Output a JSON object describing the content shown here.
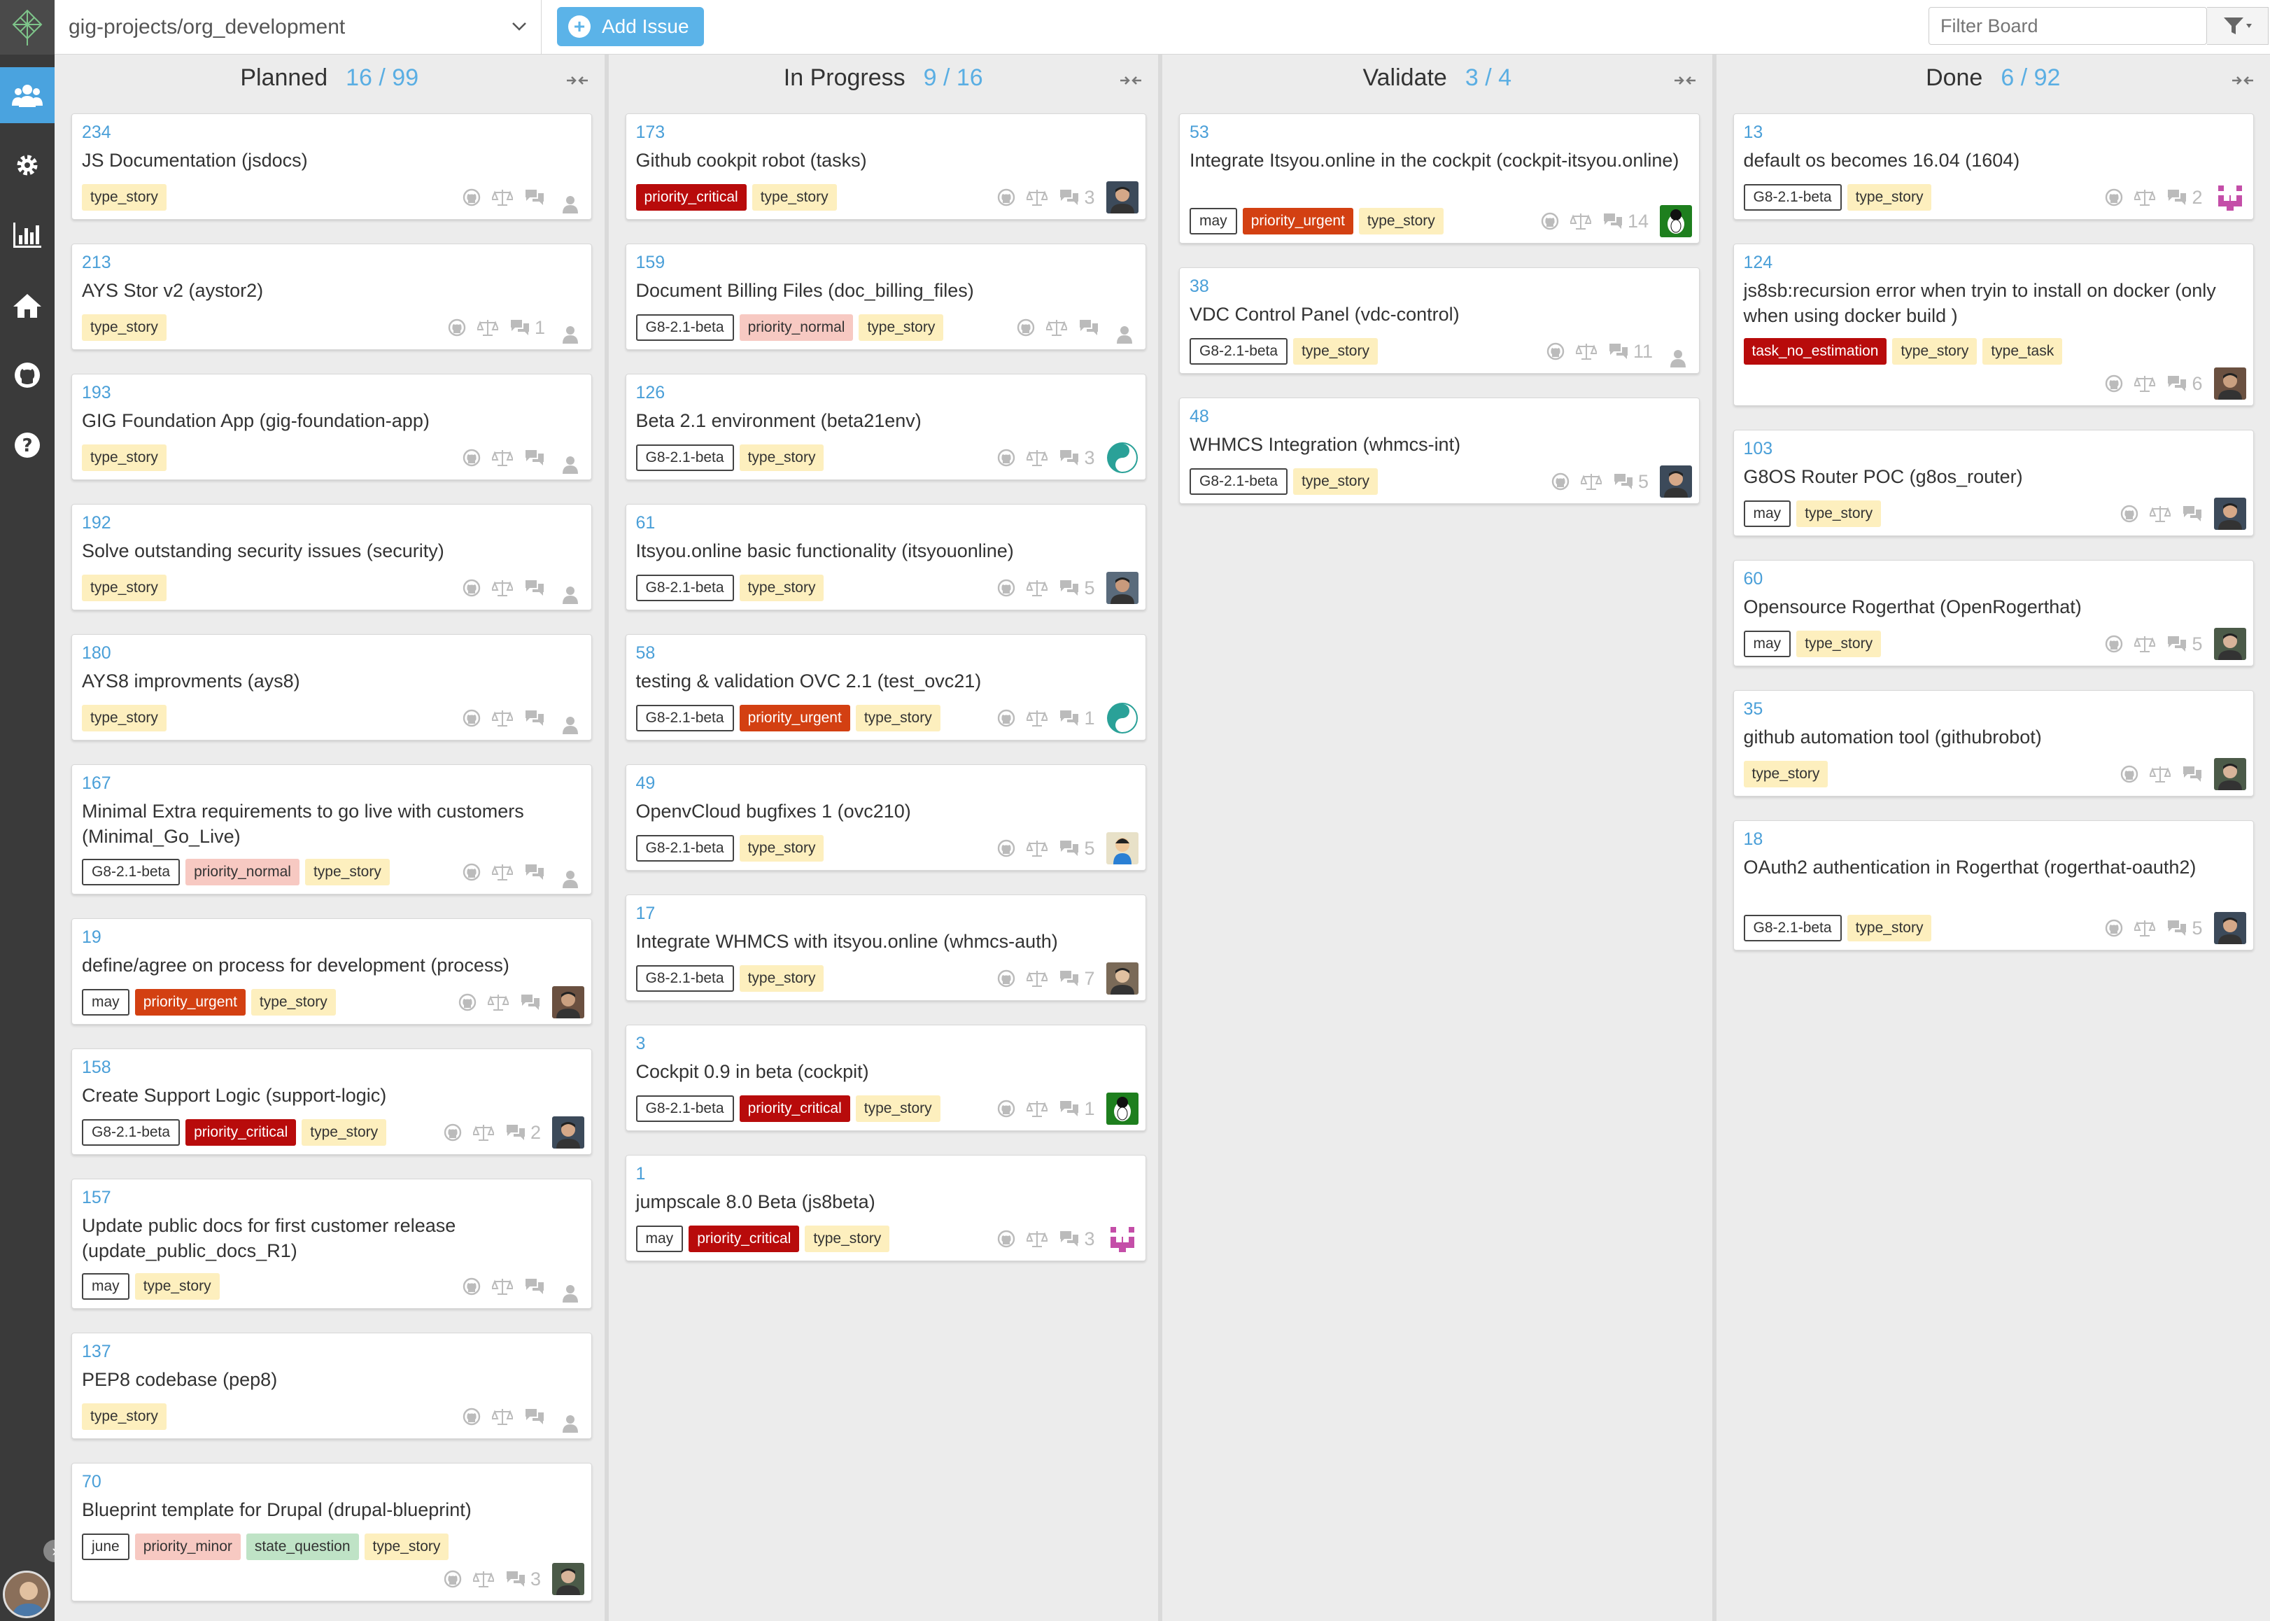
{
  "topbar": {
    "repo": "gig-projects/org_development",
    "add_issue": "Add Issue",
    "filter_placeholder": "Filter Board"
  },
  "columns": [
    {
      "name": "Planned",
      "count": "16 / 99",
      "cards": [
        {
          "num": "234",
          "title": "JS Documentation (jsdocs)",
          "tags": [
            [
              "type_story",
              "type"
            ]
          ],
          "comments": "",
          "avatar": ""
        },
        {
          "num": "213",
          "title": "AYS Stor v2 (aystor2)",
          "tags": [
            [
              "type_story",
              "type"
            ]
          ],
          "comments": "1",
          "avatar": ""
        },
        {
          "num": "193",
          "title": "GIG Foundation App (gig-foundation-app)",
          "tags": [
            [
              "type_story",
              "type"
            ]
          ],
          "comments": "",
          "avatar": ""
        },
        {
          "num": "192",
          "title": "Solve outstanding security issues (security)",
          "tags": [
            [
              "type_story",
              "type"
            ]
          ],
          "comments": "",
          "avatar": ""
        },
        {
          "num": "180",
          "title": "AYS8 improvments (ays8)",
          "tags": [
            [
              "type_story",
              "type"
            ]
          ],
          "comments": "",
          "avatar": ""
        },
        {
          "num": "167",
          "title": "Minimal Extra requirements to go live with customers (Minimal_Go_Live)",
          "tags": [
            [
              "G8-2.1-beta",
              "ms"
            ],
            [
              "priority_normal",
              "norm"
            ],
            [
              "type_story",
              "type"
            ]
          ],
          "comments": "",
          "avatar": ""
        },
        {
          "num": "19",
          "title": "define/agree on process for development (process)",
          "tags": [
            [
              "may",
              "ms"
            ],
            [
              "priority_urgent",
              "urg"
            ],
            [
              "type_story",
              "type"
            ]
          ],
          "comments": "",
          "avatar": "photo"
        },
        {
          "num": "158",
          "title": "Create Support Logic (support-logic)",
          "tags": [
            [
              "G8-2.1-beta",
              "ms"
            ],
            [
              "priority_critical",
              "crit"
            ],
            [
              "type_story",
              "type"
            ]
          ],
          "comments": "2",
          "avatar": "photo"
        },
        {
          "num": "157",
          "title": "Update public docs for first customer release (update_public_docs_R1)",
          "tags": [
            [
              "may",
              "ms"
            ],
            [
              "type_story",
              "type"
            ]
          ],
          "comments": "",
          "avatar": ""
        },
        {
          "num": "137",
          "title": "PEP8 codebase (pep8)",
          "tags": [
            [
              "type_story",
              "type"
            ]
          ],
          "comments": "",
          "avatar": ""
        },
        {
          "num": "70",
          "title": "Blueprint template for Drupal (drupal-blueprint)",
          "tags": [
            [
              "june",
              "ms"
            ],
            [
              "priority_minor",
              "minor"
            ],
            [
              "state_question",
              "state"
            ],
            [
              "type_story",
              "type"
            ]
          ],
          "comments": "3",
          "avatar": "photo"
        }
      ]
    },
    {
      "name": "In Progress",
      "count": "9 / 16",
      "cards": [
        {
          "num": "173",
          "title": "Github cookpit robot (tasks)",
          "tags": [
            [
              "priority_critical",
              "crit"
            ],
            [
              "type_story",
              "type"
            ]
          ],
          "comments": "3",
          "avatar": "photo"
        },
        {
          "num": "159",
          "title": "Document Billing Files (doc_billing_files)",
          "tags": [
            [
              "G8-2.1-beta",
              "ms"
            ],
            [
              "priority_normal",
              "norm"
            ],
            [
              "type_story",
              "type"
            ]
          ],
          "comments": "",
          "avatar": ""
        },
        {
          "num": "126",
          "title": "Beta 2.1 environment (beta21env)",
          "tags": [
            [
              "G8-2.1-beta",
              "ms"
            ],
            [
              "type_story",
              "type"
            ]
          ],
          "comments": "3",
          "avatar": "yinyang"
        },
        {
          "num": "61",
          "title": "Itsyou.online basic functionality (itsyouonline)",
          "tags": [
            [
              "G8-2.1-beta",
              "ms"
            ],
            [
              "type_story",
              "type"
            ]
          ],
          "comments": "5",
          "avatar": "photo"
        },
        {
          "num": "58",
          "title": "testing & validation OVC 2.1 (test_ovc21)",
          "tags": [
            [
              "G8-2.1-beta",
              "ms"
            ],
            [
              "priority_urgent",
              "urg"
            ],
            [
              "type_story",
              "type"
            ]
          ],
          "comments": "1",
          "avatar": "yinyang"
        },
        {
          "num": "49",
          "title": "OpenvCloud bugfixes 1 (ovc210)",
          "tags": [
            [
              "G8-2.1-beta",
              "ms"
            ],
            [
              "type_story",
              "type"
            ]
          ],
          "comments": "5",
          "avatar": "cartoon"
        },
        {
          "num": "17",
          "title": "Integrate WHMCS with itsyou.online (whmcs-auth)",
          "tags": [
            [
              "G8-2.1-beta",
              "ms"
            ],
            [
              "type_story",
              "type"
            ]
          ],
          "comments": "7",
          "avatar": "photo"
        },
        {
          "num": "3",
          "title": "Cockpit 0.9 in beta (cockpit)",
          "tags": [
            [
              "G8-2.1-beta",
              "ms"
            ],
            [
              "priority_critical",
              "crit"
            ],
            [
              "type_story",
              "type"
            ]
          ],
          "comments": "1",
          "avatar": "green"
        },
        {
          "num": "1",
          "title": "jumpscale 8.0 Beta (js8beta)",
          "tags": [
            [
              "may",
              "ms"
            ],
            [
              "priority_critical",
              "crit"
            ],
            [
              "type_story",
              "type"
            ]
          ],
          "comments": "3",
          "avatar": "pink"
        }
      ]
    },
    {
      "name": "Validate",
      "count": "3 / 4",
      "cards": [
        {
          "num": "53",
          "title": "Integrate Itsyou.online in the cockpit (cockpit-itsyou.online)",
          "tags": [
            [
              "may",
              "ms"
            ],
            [
              "priority_urgent",
              "urg"
            ],
            [
              "type_story",
              "type"
            ]
          ],
          "comments": "14",
          "avatar": "green"
        },
        {
          "num": "38",
          "title": "VDC Control Panel (vdc-control)",
          "tags": [
            [
              "G8-2.1-beta",
              "ms"
            ],
            [
              "type_story",
              "type"
            ]
          ],
          "comments": "11",
          "avatar": ""
        },
        {
          "num": "48",
          "title": "WHMCS Integration (whmcs-int)",
          "tags": [
            [
              "G8-2.1-beta",
              "ms"
            ],
            [
              "type_story",
              "type"
            ]
          ],
          "comments": "5",
          "avatar": "photo"
        }
      ]
    },
    {
      "name": "Done",
      "count": "6 / 92",
      "cards": [
        {
          "num": "13",
          "title": "default os becomes 16.04 (1604)",
          "tags": [
            [
              "G8-2.1-beta",
              "ms"
            ],
            [
              "type_story",
              "type"
            ]
          ],
          "comments": "2",
          "avatar": "pink"
        },
        {
          "num": "124",
          "title": "js8sb:recursion error when tryin to install on docker (only when using docker build )",
          "tags": [
            [
              "task_no_estimation",
              "noest"
            ],
            [
              "type_story",
              "type"
            ],
            [
              "type_task",
              "type"
            ]
          ],
          "comments": "6",
          "avatar": "photo"
        },
        {
          "num": "103",
          "title": "G8OS Router POC (g8os_router)",
          "tags": [
            [
              "may",
              "ms"
            ],
            [
              "type_story",
              "type"
            ]
          ],
          "comments": "",
          "avatar": "photo"
        },
        {
          "num": "60",
          "title": "Opensource Rogerthat (OpenRogerthat)",
          "tags": [
            [
              "may",
              "ms"
            ],
            [
              "type_story",
              "type"
            ]
          ],
          "comments": "5",
          "avatar": "photo"
        },
        {
          "num": "35",
          "title": "github automation tool (githubrobot)",
          "tags": [
            [
              "type_story",
              "type"
            ]
          ],
          "comments": "",
          "avatar": "photo"
        },
        {
          "num": "18",
          "title": "OAuth2 authentication in Rogerthat (rogerthat-oauth2)",
          "tags": [
            [
              "G8-2.1-beta",
              "ms"
            ],
            [
              "type_story",
              "type"
            ]
          ],
          "comments": "5",
          "avatar": "photo"
        }
      ]
    }
  ]
}
